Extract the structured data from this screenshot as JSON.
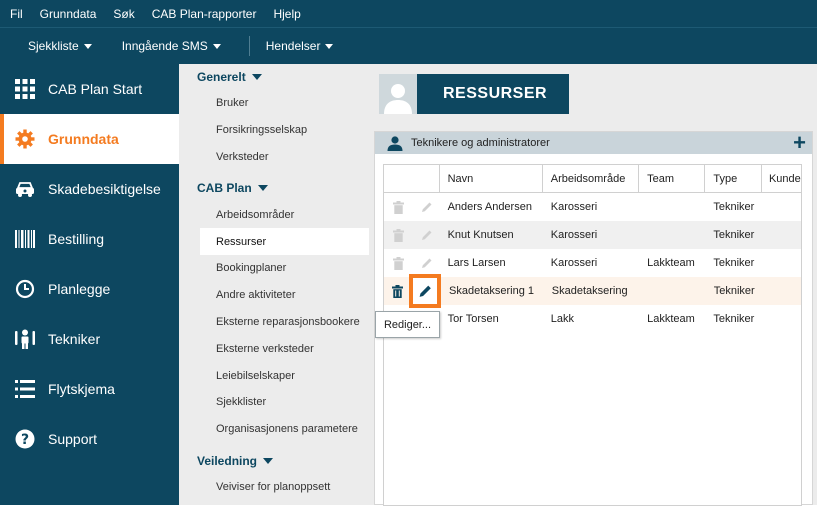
{
  "menu": [
    "Fil",
    "Grunndata",
    "Søk",
    "CAB Plan-rapporter",
    "Hjelp"
  ],
  "toolbar": {
    "checklist": "Sjekkliste",
    "sms": "Inngående SMS",
    "events": "Hendelser"
  },
  "nav": [
    {
      "label": "CAB Plan Start",
      "icon": "grid-icon"
    },
    {
      "label": "Grunndata",
      "icon": "gear-icon",
      "active": true
    },
    {
      "label": "Skadebesiktigelse",
      "icon": "car-damage-icon"
    },
    {
      "label": "Bestilling",
      "icon": "barcode-icon"
    },
    {
      "label": "Planlegge",
      "icon": "clock-icon"
    },
    {
      "label": "Tekniker",
      "icon": "technician-icon"
    },
    {
      "label": "Flytskjema",
      "icon": "list-icon"
    },
    {
      "label": "Support",
      "icon": "help-icon"
    }
  ],
  "subnav": {
    "generelt": {
      "title": "Generelt",
      "items": [
        "Bruker",
        "Forsikringsselskap",
        "Verksteder"
      ]
    },
    "cabplan": {
      "title": "CAB Plan",
      "items": [
        "Arbeidsområder",
        "Ressurser",
        "Bookingplaner",
        "Andre aktiviteter",
        "Eksterne reparasjonsbookere",
        "Eksterne verksteder",
        "Leiebilselskaper",
        "Sjekklister",
        "Organisasjonens parametere"
      ]
    },
    "veiledning": {
      "title": "Veiledning",
      "items": [
        "Veiviser for planoppsett"
      ]
    }
  },
  "page": {
    "title": "RESSURSER",
    "panel_title": "Teknikere og administratorer"
  },
  "table": {
    "headers": [
      "Navn",
      "Arbeidsområde",
      "Team",
      "Type",
      "Kunde"
    ],
    "rows": [
      {
        "name": "Anders Andersen",
        "area": "Karosseri",
        "team": "",
        "type": "Tekniker"
      },
      {
        "name": "Knut Knutsen",
        "area": "Karosseri",
        "team": "",
        "type": "Tekniker"
      },
      {
        "name": "Lars Larsen",
        "area": "Karosseri",
        "team": "Lakkteam",
        "type": "Tekniker"
      },
      {
        "name": "Skadetaksering 1",
        "area": "Skadetaksering",
        "team": "",
        "type": "Tekniker"
      },
      {
        "name": "Tor Torsen",
        "area": "Lakk",
        "team": "Lakkteam",
        "type": "Tekniker"
      }
    ]
  },
  "tooltip": "Rediger...",
  "colors": {
    "brand": "#0d4760",
    "accent": "#f47b20"
  }
}
